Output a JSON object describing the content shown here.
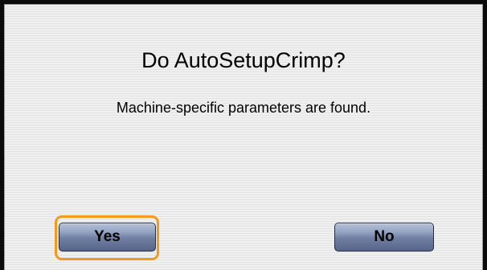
{
  "dialog": {
    "title": "Do AutoSetupCrimp?",
    "message": "Machine-specific parameters are found.",
    "yes_label": "Yes",
    "no_label": "No"
  },
  "colors": {
    "focus_ring": "#f39a1e",
    "button_top": "#b4c0d6",
    "button_bottom": "#56658a",
    "background": "#ececec"
  }
}
